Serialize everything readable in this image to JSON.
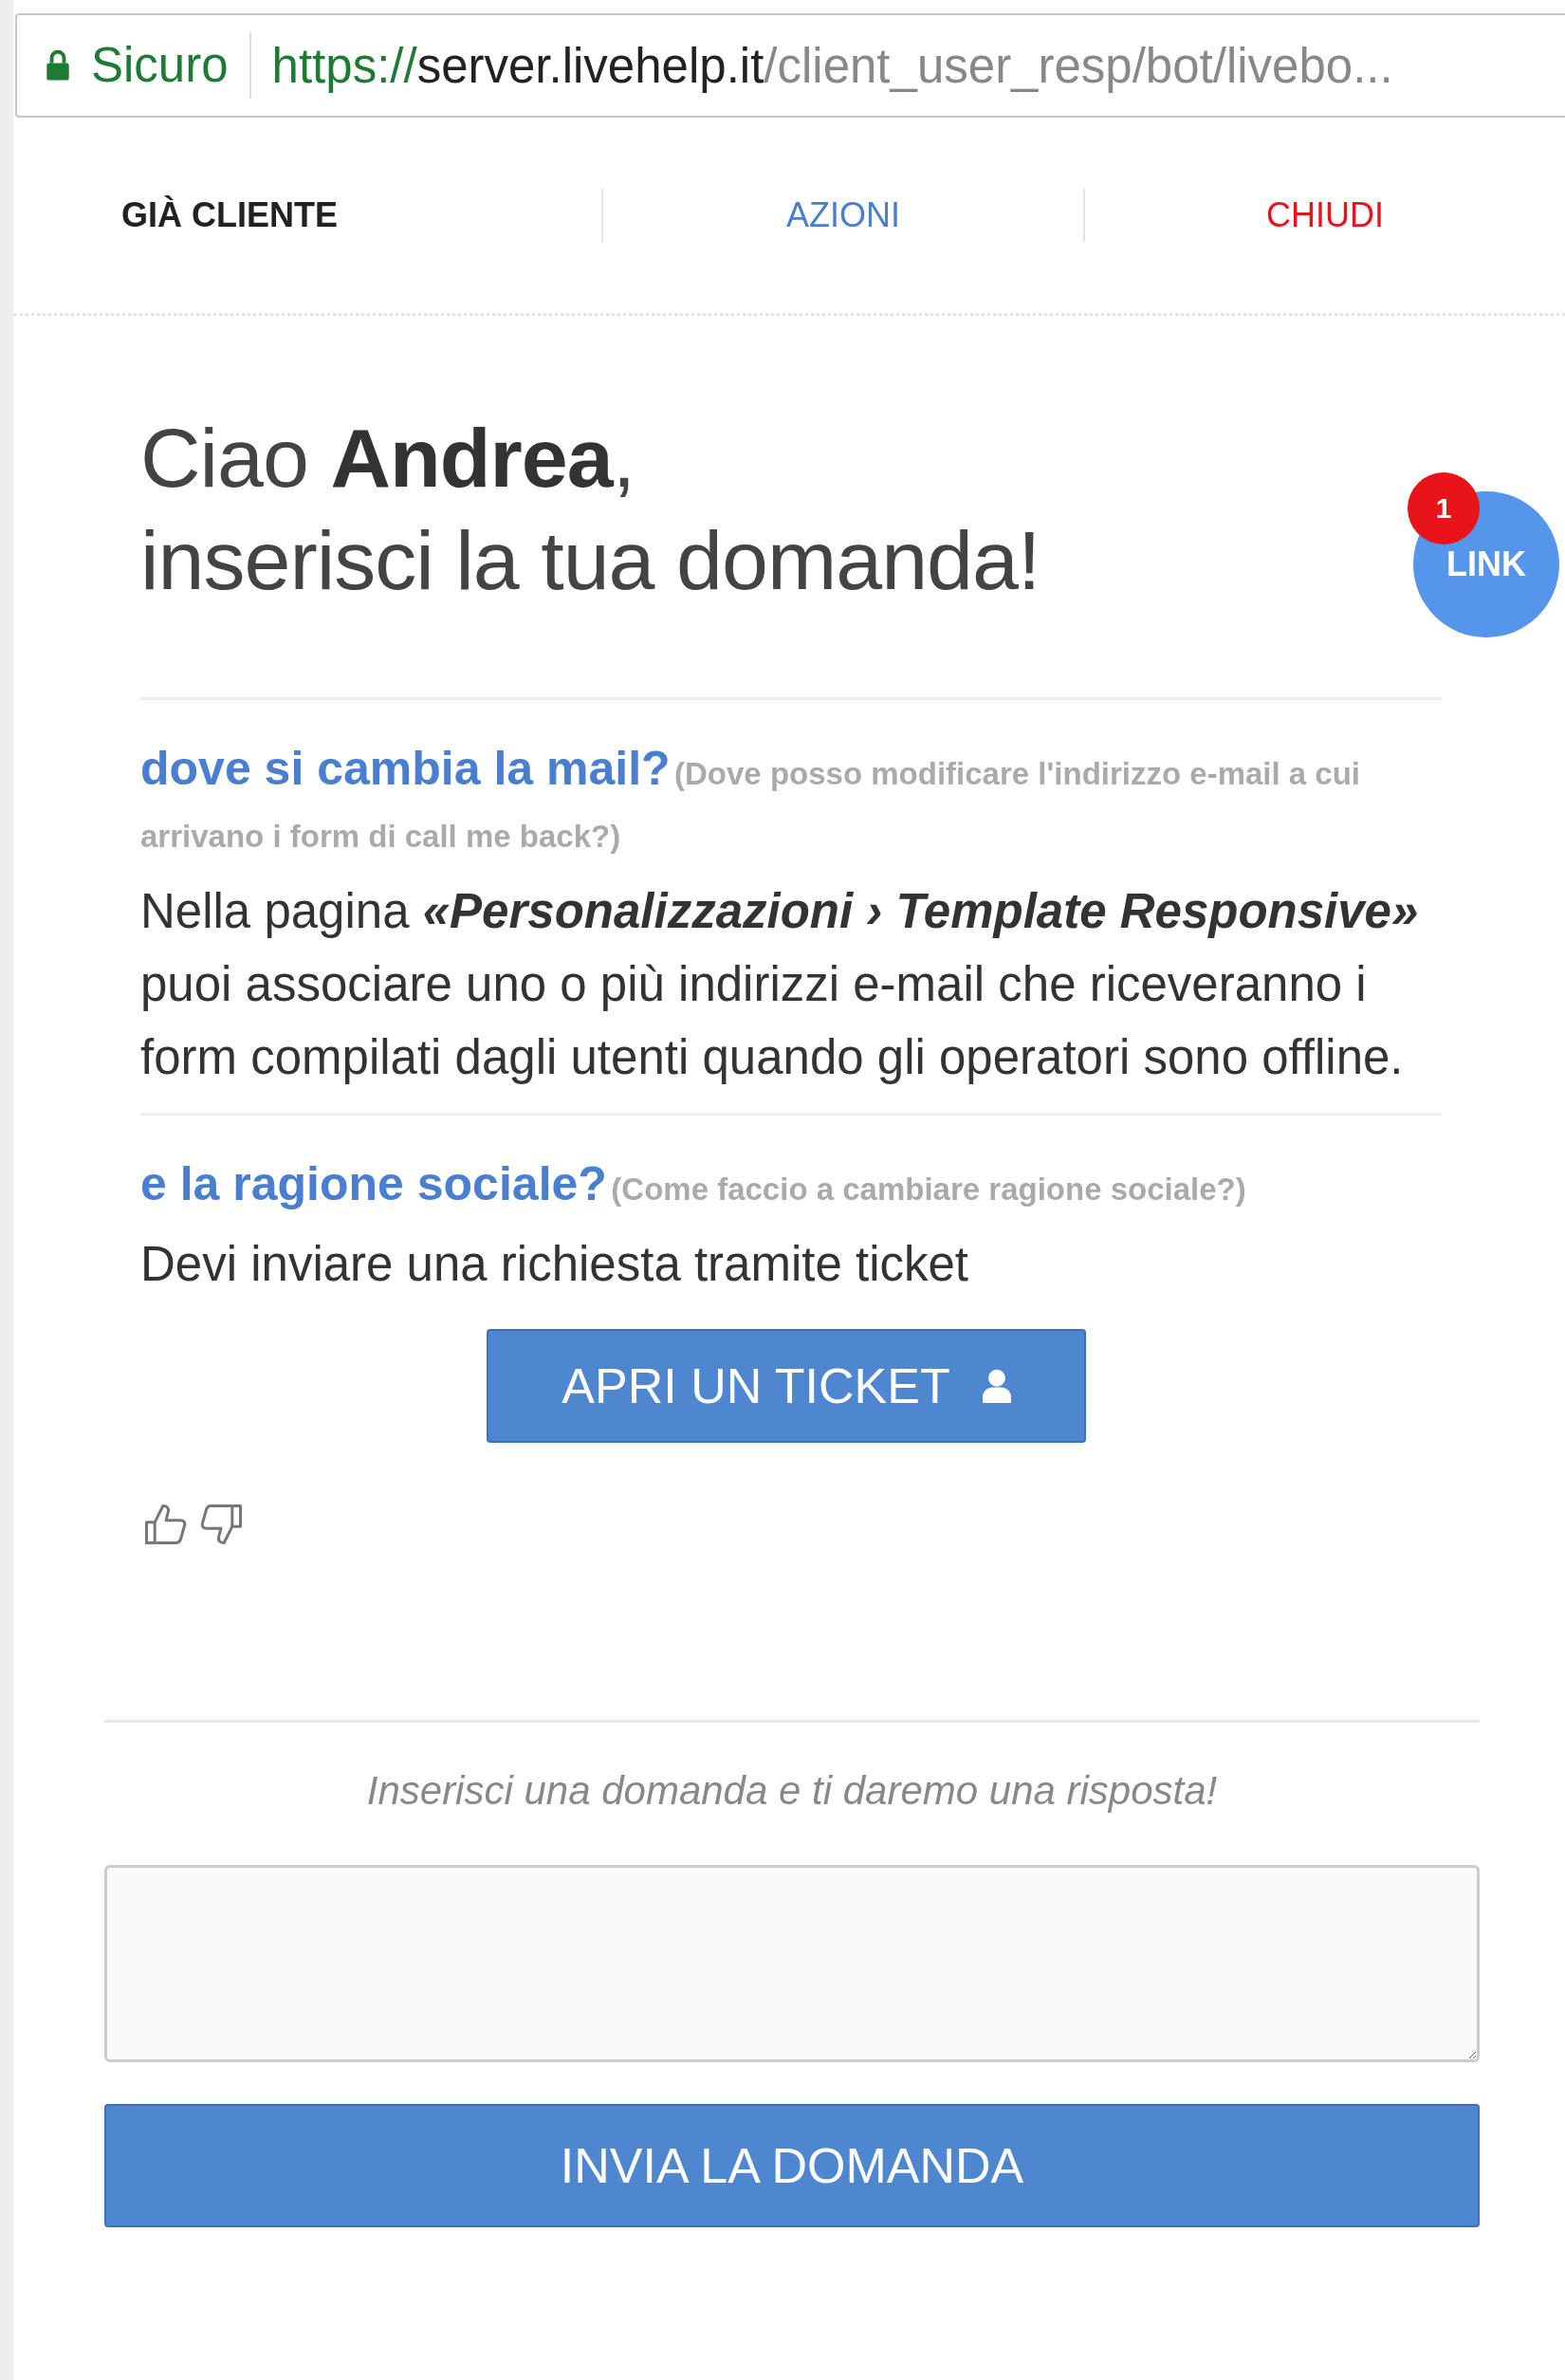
{
  "address_bar": {
    "security_label": "Sicuro",
    "url_scheme": "https://",
    "url_host": "server.livehelp.it",
    "url_path": "/client_user_resp/bot/livebo..."
  },
  "nav": [
    {
      "label": "GIÀ CLIENTE",
      "kind": "title"
    },
    {
      "label": "AZIONI",
      "kind": "link"
    },
    {
      "label": "CHIUDI",
      "kind": "close"
    }
  ],
  "greeting": {
    "line_1": "Ciao **Andrea**,",
    "line_2": "inserisci la tua domanda!"
  },
  "link_bubble": {
    "label": "LINK",
    "badge": "1"
  },
  "answers": [
    {
      "question": "dove si cambia la mail?",
      "original_question": "(Dove posso modificare l'indirizzo e-mail a cui arrivano i form di call me back?)",
      "answer": "Nella pagina *«Personalizzazioni › Template Responsive»* puoi associare uno o più indirizzi e-mail che riceveranno i form compilati dagli utenti quando gli operatori sono offline."
    },
    {
      "question": "e la ragione sociale?",
      "original_question": "(Come faccio a cambiare ragione sociale?)",
      "answer": "Devi inviare una richiesta tramite ticket",
      "action": "APRI UN TICKET"
    }
  ],
  "prompt": "Inserisci una domanda e ti daremo una risposta!",
  "submit_button": "INVIA LA DOMANDA"
}
